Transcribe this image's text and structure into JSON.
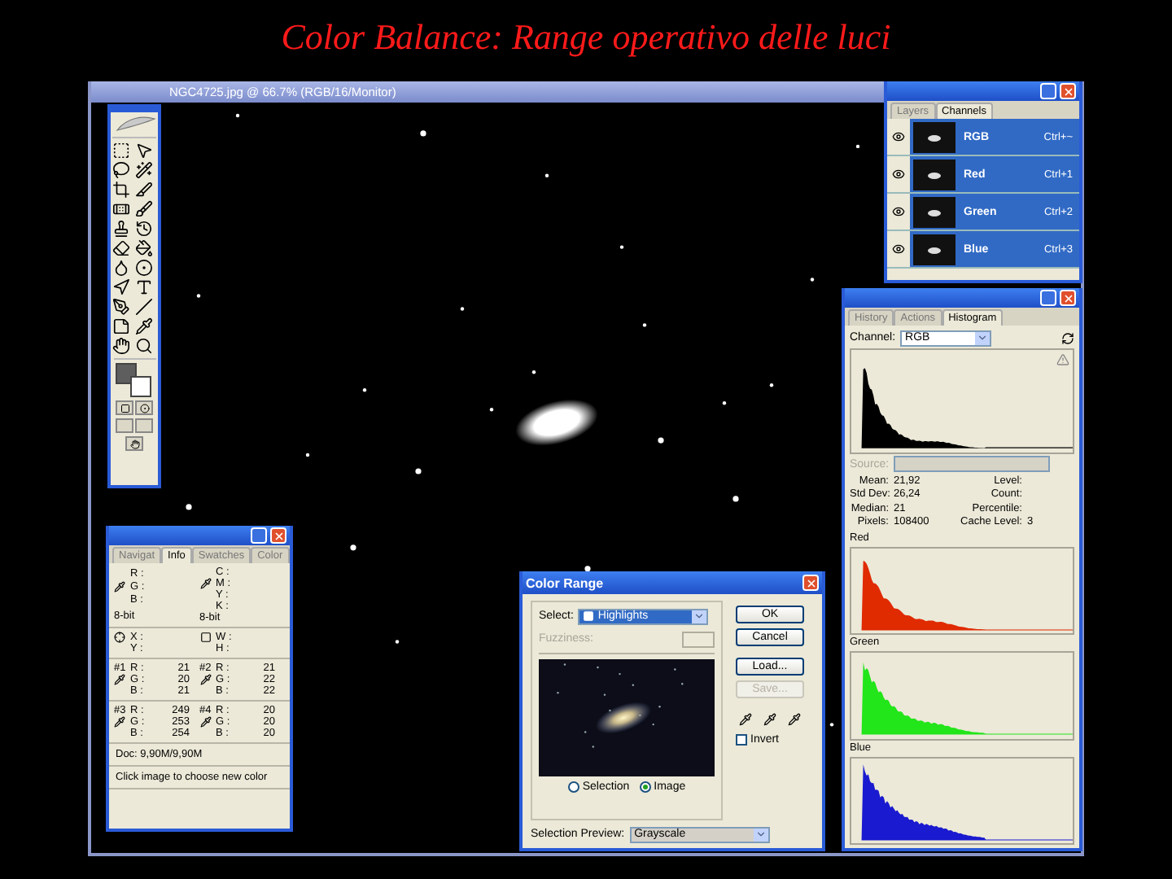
{
  "slide_title": "Color Balance: Range operativo delle luci",
  "document_window": {
    "title": "NGC4725.jpg @ 66.7% (RGB/16/Monitor)"
  },
  "channels_panel": {
    "tabs": [
      {
        "label": "Layers",
        "selected": false
      },
      {
        "label": "Channels",
        "selected": true
      }
    ],
    "channels": [
      {
        "name": "RGB",
        "shortcut": "Ctrl+~",
        "selected": true
      },
      {
        "name": "Red",
        "shortcut": "Ctrl+1",
        "selected": true
      },
      {
        "name": "Green",
        "shortcut": "Ctrl+2",
        "selected": true
      },
      {
        "name": "Blue",
        "shortcut": "Ctrl+3",
        "selected": true
      }
    ]
  },
  "histogram_panel": {
    "tabs": [
      {
        "label": "History",
        "selected": false
      },
      {
        "label": "Actions",
        "selected": false
      },
      {
        "label": "Histogram",
        "selected": true
      }
    ],
    "channel_label": "Channel:",
    "channel_value": "RGB",
    "source_label": "Source:",
    "left_stats": [
      {
        "label": "Mean:",
        "value": "21,92"
      },
      {
        "label": "Std Dev:",
        "value": "26,24"
      },
      {
        "label": "Median:",
        "value": "21"
      },
      {
        "label": "Pixels:",
        "value": "108400"
      }
    ],
    "right_stats": [
      {
        "label": "Level:"
      },
      {
        "label": "Count:"
      },
      {
        "label": "Percentile:"
      },
      {
        "label": "Cache Level:",
        "value": "3"
      }
    ],
    "channel_histograms": [
      {
        "name": "Red",
        "color": "#e02a00"
      },
      {
        "name": "Green",
        "color": "#22e51a"
      },
      {
        "name": "Blue",
        "color": "#1a1ad0"
      }
    ]
  },
  "info_panel": {
    "tabs": [
      {
        "label": "Navigat",
        "selected": false
      },
      {
        "label": "Info",
        "selected": true
      },
      {
        "label": "Swatches",
        "selected": false
      },
      {
        "label": "Color",
        "selected": false
      }
    ],
    "readouts": [
      {
        "labels": [
          "R :",
          "G :",
          "B :"
        ],
        "mode": "8-bit"
      },
      {
        "labels": [
          "C :",
          "M :",
          "Y :",
          "K :"
        ],
        "mode": "8-bit"
      }
    ],
    "position_labels": [
      "X :",
      "Y :"
    ],
    "size_labels": [
      "W :",
      "H :"
    ],
    "samplers": [
      {
        "marker": "#1",
        "rows": [
          {
            "label": "R :",
            "value": "21"
          },
          {
            "label": "G :",
            "value": "20"
          },
          {
            "label": "B :",
            "value": "21"
          }
        ]
      },
      {
        "marker": "#2",
        "rows": [
          {
            "label": "R :",
            "value": "21"
          },
          {
            "label": "G :",
            "value": "22"
          },
          {
            "label": "B :",
            "value": "22"
          }
        ]
      },
      {
        "marker": "#3",
        "rows": [
          {
            "label": "R :",
            "value": "249"
          },
          {
            "label": "G :",
            "value": "253"
          },
          {
            "label": "B :",
            "value": "254"
          }
        ]
      },
      {
        "marker": "#4",
        "rows": [
          {
            "label": "R :",
            "value": "20"
          },
          {
            "label": "G :",
            "value": "20"
          },
          {
            "label": "B :",
            "value": "20"
          }
        ]
      }
    ],
    "doc": "Doc: 9,90M/9,90M",
    "hint": "Click image to choose new color"
  },
  "color_range_dialog": {
    "title": "Color Range",
    "select_label": "Select:",
    "select_value": "Highlights",
    "fuzziness_label": "Fuzziness:",
    "preview_options": [
      {
        "label": "Selection",
        "selected": false
      },
      {
        "label": "Image",
        "selected": true
      }
    ],
    "selection_preview_label": "Selection Preview:",
    "selection_preview_value": "Grayscale",
    "buttons": [
      {
        "label": "OK",
        "disabled": false
      },
      {
        "label": "Cancel",
        "disabled": false
      },
      {
        "label": "Load...",
        "disabled": false
      },
      {
        "label": "Save...",
        "disabled": true
      }
    ],
    "invert": {
      "label": "Invert",
      "checked": false
    }
  }
}
